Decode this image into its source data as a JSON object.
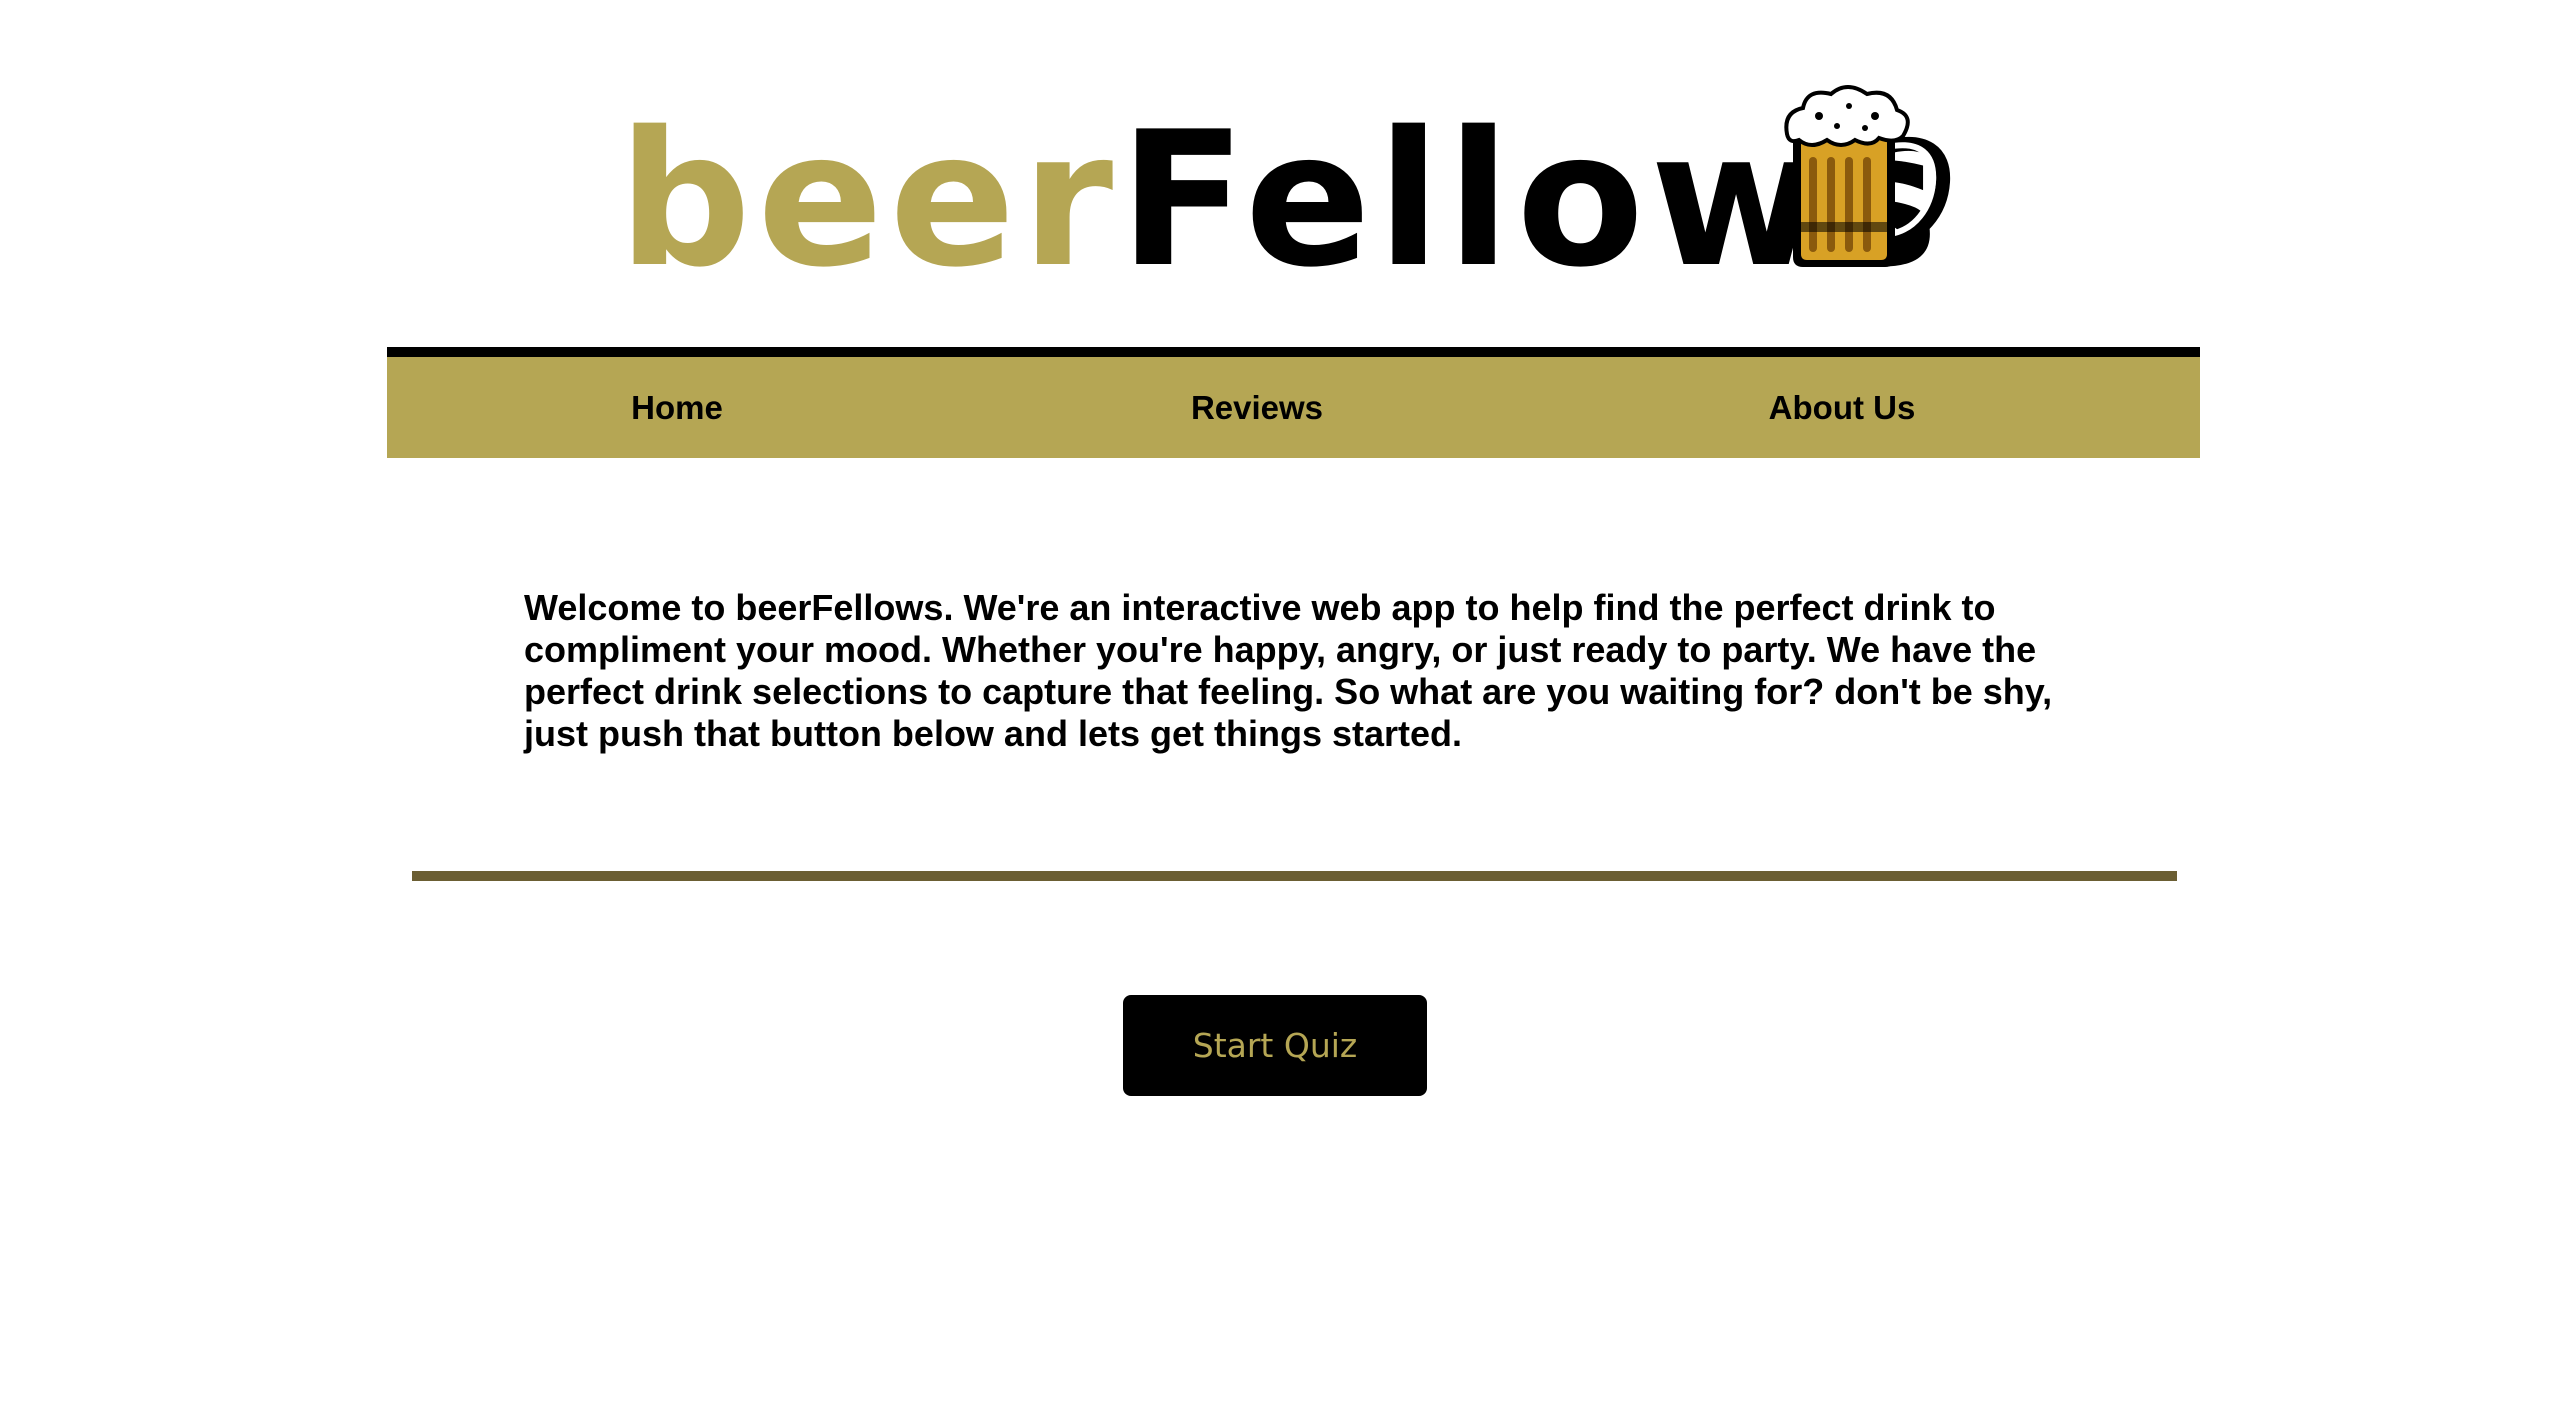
{
  "logo": {
    "part1": "beer",
    "part2": "Fellows",
    "icon": "beer-mug-icon",
    "color_part1": "#b5a654",
    "color_part2": "#000000"
  },
  "nav": {
    "items": [
      {
        "label": "Home"
      },
      {
        "label": "Reviews"
      },
      {
        "label": "About Us"
      }
    ],
    "background": "#b5a654",
    "border_color": "#000000"
  },
  "intro": {
    "text": "Welcome to beerFellows. We're an interactive web app to help find the perfect drink to compliment your mood. Whether you're happy, angry, or just ready to party. We have the perfect drink selections to capture that feeling. So what are you waiting for? don't be shy, just push that button below and lets get things started."
  },
  "divider": {
    "color": "#6b5e33"
  },
  "quiz": {
    "button_label": "Start Quiz",
    "button_bg": "#000000",
    "button_text_color": "#b5a654"
  }
}
